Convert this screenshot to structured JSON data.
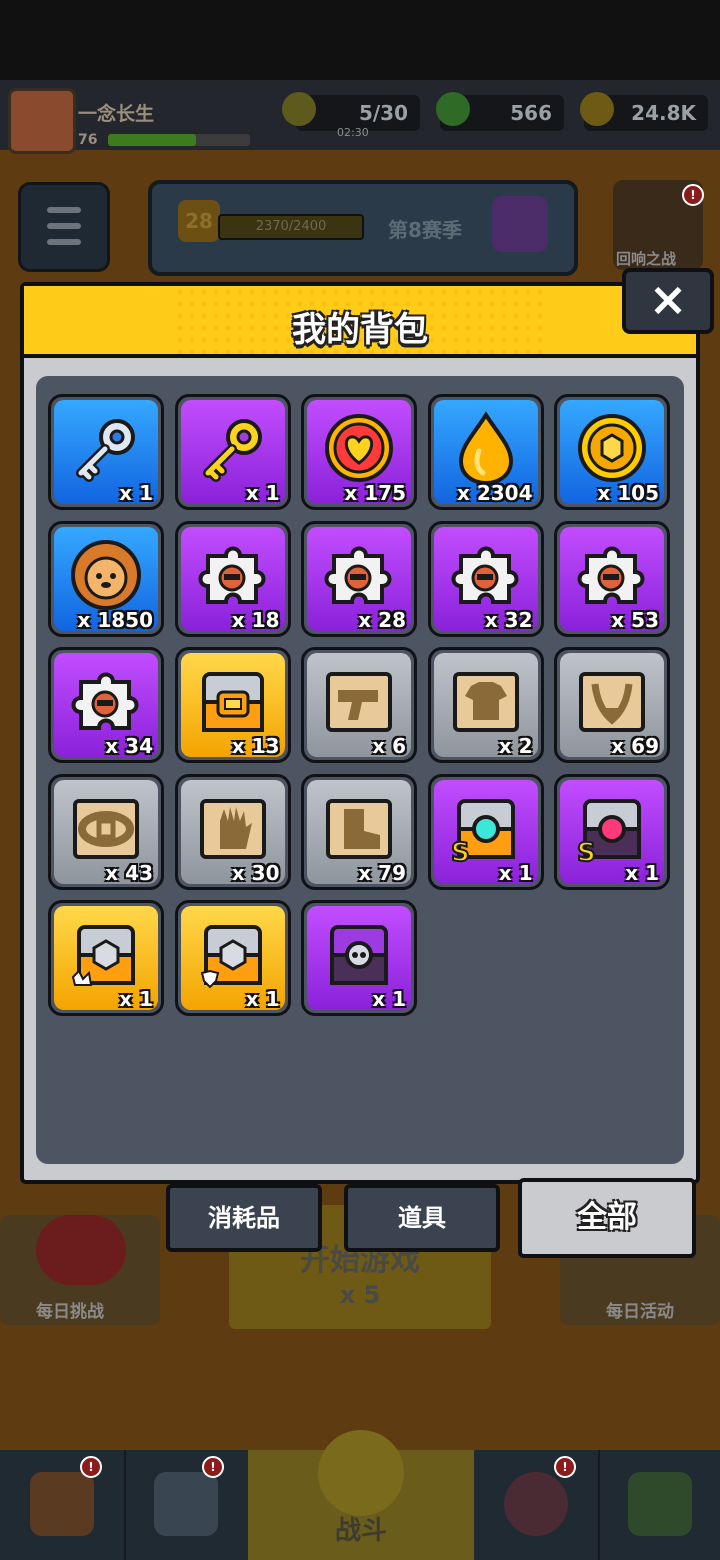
{
  "player": {
    "name": "一念长生",
    "level": "76",
    "xp_fraction": 0.62
  },
  "resources": {
    "energy": "5/30",
    "energy_timer": "02:30",
    "gems": "566",
    "coins": "24.8K"
  },
  "season": {
    "level": "28",
    "progress": "2370/2400",
    "name": "第8赛季",
    "progress_fraction": 0.9875
  },
  "events": {
    "echo_battle": "回响之战",
    "daily_challenge": "每日挑战",
    "daily_activity": "每日活动"
  },
  "start_game": {
    "label": "开始游戏",
    "cost": "x 5"
  },
  "bottom_nav": {
    "battle": "战斗"
  },
  "modal": {
    "title": "我的背包",
    "close": "×"
  },
  "tabs": [
    {
      "label": "消耗品",
      "active": false
    },
    {
      "label": "道具",
      "active": false
    },
    {
      "label": "全部",
      "active": true
    }
  ],
  "items": [
    {
      "icon": "silver-key-icon",
      "rarity": "blue",
      "qty": "x 1"
    },
    {
      "icon": "gold-key-icon",
      "rarity": "purple",
      "qty": "x 1"
    },
    {
      "icon": "heart-coin-icon",
      "rarity": "purple",
      "qty": "x 175"
    },
    {
      "icon": "flame-drop-icon",
      "rarity": "blue",
      "qty": "x 2304"
    },
    {
      "icon": "gold-coin-icon",
      "rarity": "blue",
      "qty": "x 105"
    },
    {
      "icon": "lion-cookie-icon",
      "rarity": "blue",
      "qty": "x 1850"
    },
    {
      "icon": "puzzle-piece-icon",
      "rarity": "purple",
      "qty": "x 18"
    },
    {
      "icon": "puzzle-piece-icon",
      "rarity": "purple",
      "qty": "x 28"
    },
    {
      "icon": "puzzle-piece-icon",
      "rarity": "purple",
      "qty": "x 32"
    },
    {
      "icon": "puzzle-piece-icon",
      "rarity": "purple",
      "qty": "x 53"
    },
    {
      "icon": "puzzle-piece-icon",
      "rarity": "purple",
      "qty": "x 34"
    },
    {
      "icon": "treasure-chest-icon",
      "rarity": "gold",
      "qty": "x 13"
    },
    {
      "icon": "gun-blueprint-icon",
      "rarity": "gray",
      "qty": "x 6"
    },
    {
      "icon": "shirt-blueprint-icon",
      "rarity": "gray",
      "qty": "x 2"
    },
    {
      "icon": "necklace-blueprint-icon",
      "rarity": "gray",
      "qty": "x 69"
    },
    {
      "icon": "belt-blueprint-icon",
      "rarity": "gray",
      "qty": "x 43"
    },
    {
      "icon": "glove-blueprint-icon",
      "rarity": "gray",
      "qty": "x 30"
    },
    {
      "icon": "boot-blueprint-icon",
      "rarity": "gray",
      "qty": "x 79"
    },
    {
      "icon": "s-chest-cyan-icon",
      "rarity": "purple",
      "qty": "x 1"
    },
    {
      "icon": "s-chest-pink-icon",
      "rarity": "purple",
      "qty": "x 1"
    },
    {
      "icon": "gold-chest-claw-icon",
      "rarity": "gold",
      "qty": "x 1"
    },
    {
      "icon": "gold-chest-shield-icon",
      "rarity": "gold",
      "qty": "x 1"
    },
    {
      "icon": "dark-chest-icon",
      "rarity": "purple",
      "qty": "x 1"
    }
  ],
  "colors": {
    "blue": "#1f7cf0",
    "purple": "#a631ee",
    "gold": "#ffc21a",
    "gray": "#a5aab1",
    "header": "#ffcc1a"
  }
}
